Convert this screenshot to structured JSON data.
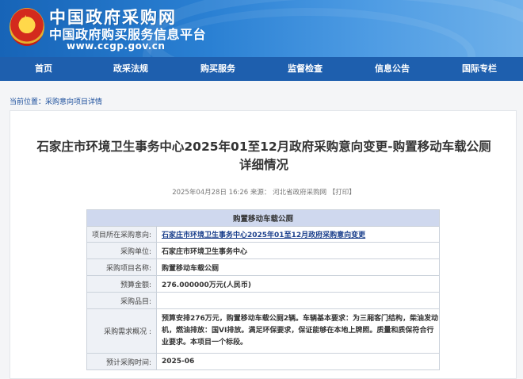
{
  "header": {
    "site_name": "中国政府采购网",
    "platform_name": "中国政府购买服务信息平台",
    "url": "www.ccgp.gov.cn"
  },
  "nav": {
    "items": [
      "首页",
      "政采法规",
      "购买服务",
      "监督检查",
      "信息公告",
      "国际专栏"
    ]
  },
  "breadcrumb": {
    "prefix": "当前位置：",
    "link": "采购意向项目详情"
  },
  "article": {
    "title_line1": "石家庄市环境卫生事务中心2025年01至12月政府采购意向变更-购置移动车载公厕",
    "title_line2": "详细情况",
    "meta": "2025年04月28日 16:26 来源：  河北省政府采购网  【打印】"
  },
  "table": {
    "header": "购置移动车载公厕",
    "rows": [
      {
        "label": "项目所在采购意向:",
        "value": "石家庄市环境卫生事务中心2025年01至12月政府采购意向变更"
      },
      {
        "label": "采购单位:",
        "value": "石家庄市环境卫生事务中心"
      },
      {
        "label": "采购项目名称:",
        "value": "购置移动车载公厕"
      },
      {
        "label": "预算金额:",
        "value": "276.000000万元(人民币)"
      },
      {
        "label": "采购品目:",
        "value": ""
      },
      {
        "label": "采购需求概况 :",
        "value": "预算安排276万元，购置移动车载公厕2辆。车辆基本要求：为三厢客门结构，柴油发动机，燃油排放：国VI排放。满足环保要求，保证能够在本地上牌照。质量和质保符合行业要求。本项目一个标段。"
      },
      {
        "label": "预计采购时间:",
        "value": "2025-06"
      }
    ]
  }
}
